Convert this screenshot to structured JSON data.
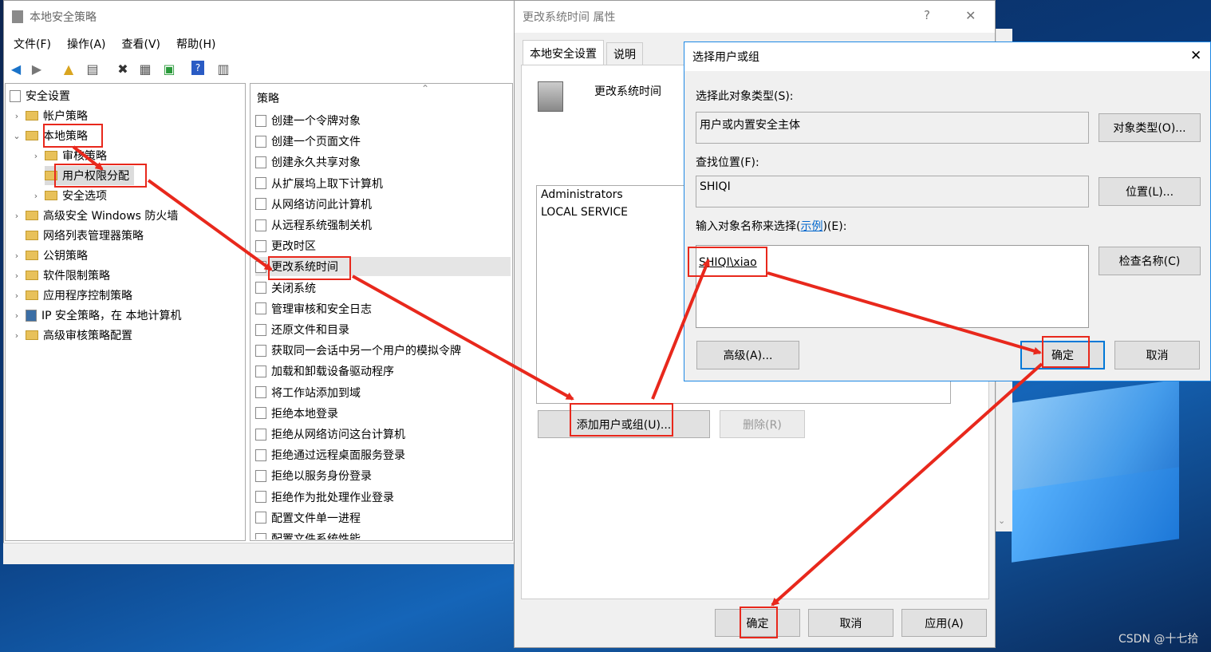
{
  "lsp": {
    "title": "本地安全策略",
    "menu": [
      "文件(F)",
      "操作(A)",
      "查看(V)",
      "帮助(H)"
    ],
    "tree": [
      {
        "label": "安全设置"
      },
      {
        "label": "帐户策略"
      },
      {
        "label": "本地策略"
      },
      {
        "label": "审核策略"
      },
      {
        "label": "用户权限分配"
      },
      {
        "label": "安全选项"
      },
      {
        "label": "高级安全 Windows 防火墙"
      },
      {
        "label": "网络列表管理器策略"
      },
      {
        "label": "公钥策略"
      },
      {
        "label": "软件限制策略"
      },
      {
        "label": "应用程序控制策略"
      },
      {
        "label": "IP 安全策略，在 本地计算机"
      },
      {
        "label": "高级审核策略配置"
      }
    ],
    "policy_header": "策略",
    "policies": [
      "创建一个令牌对象",
      "创建一个页面文件",
      "创建永久共享对象",
      "从扩展坞上取下计算机",
      "从网络访问此计算机",
      "从远程系统强制关机",
      "更改时区",
      "更改系统时间",
      "关闭系统",
      "管理审核和安全日志",
      "还原文件和目录",
      "获取同一会话中另一个用户的模拟令牌",
      "加载和卸载设备驱动程序",
      "将工作站添加到域",
      "拒绝本地登录",
      "拒绝从网络访问这台计算机",
      "拒绝通过远程桌面服务登录",
      "拒绝以服务身份登录",
      "拒绝作为批处理作业登录",
      "配置文件单一进程",
      "配置文件系统性能"
    ]
  },
  "props": {
    "title": "更改系统时间 属性",
    "help": "?",
    "close": "✕",
    "tabs": [
      "本地安全设置",
      "说明"
    ],
    "policy_name": "更改系统时间",
    "members": [
      "Administrators",
      "LOCAL SERVICE"
    ],
    "add_button": "添加用户或组(U)...",
    "remove_button": "删除(R)",
    "ok": "确定",
    "cancel": "取消",
    "apply": "应用(A)"
  },
  "select": {
    "title": "选择用户或组",
    "close": "✕",
    "obj_type_label": "选择此对象类型(S):",
    "obj_type_value": "用户或内置安全主体",
    "obj_type_button": "对象类型(O)...",
    "location_label": "查找位置(F):",
    "location_value": "SHIQI",
    "location_button": "位置(L)...",
    "enter_label_pre": "输入对象名称来选择(",
    "enter_label_link": "示例",
    "enter_label_post": ")(E):",
    "entered_name": "SHIQI\\xiao",
    "check_button": "检查名称(C)",
    "advanced_button": "高级(A)...",
    "ok": "确定",
    "cancel": "取消"
  },
  "watermark": "CSDN @十七拾",
  "colors": {
    "annotation": "#e8281c",
    "accent": "#0078d7"
  }
}
